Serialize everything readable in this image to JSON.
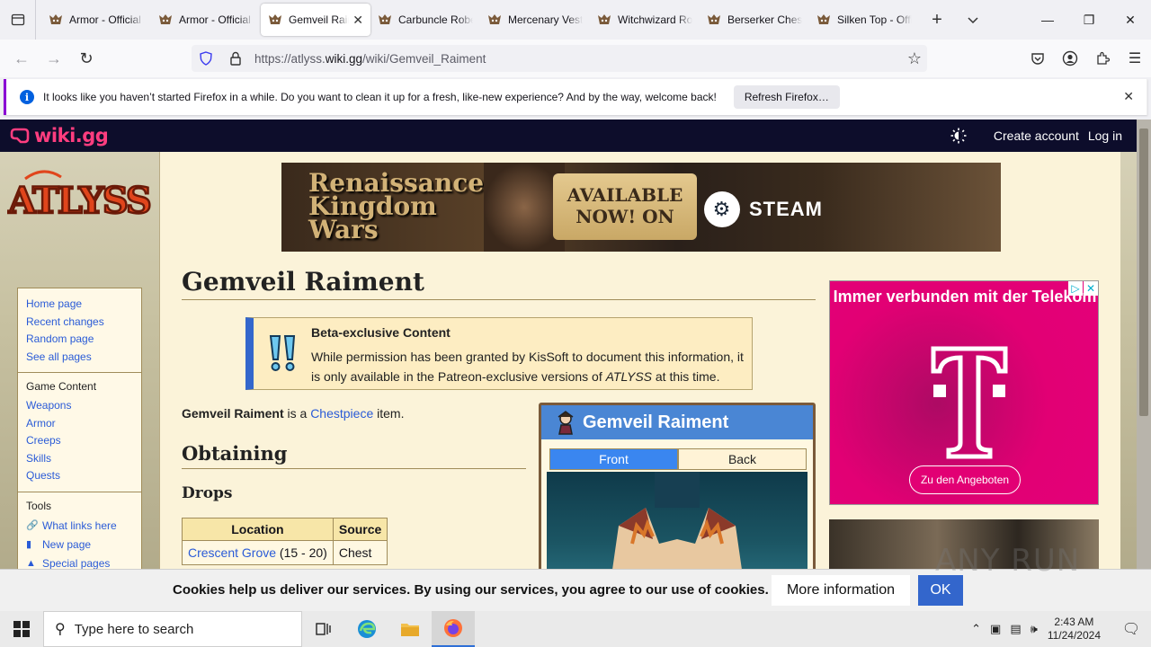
{
  "browser": {
    "tabs": [
      {
        "title": "Armor - Official ATLYSS Wiki",
        "active": false
      },
      {
        "title": "Armor - Official ATLYSS Wiki",
        "active": false
      },
      {
        "title": "Gemveil Raiment",
        "active": true
      },
      {
        "title": "Carbuncle Robe",
        "active": false
      },
      {
        "title": "Mercenary Vest",
        "active": false
      },
      {
        "title": "Witchwizard Robe",
        "active": false
      },
      {
        "title": "Berserker Chestpiece",
        "active": false
      },
      {
        "title": "Silken Top - Official ATLYSS Wiki",
        "active": false
      }
    ],
    "url_prefix": "https://atlyss.",
    "url_domain": "wiki.gg",
    "url_path": "/wiki/Gemveil_Raiment",
    "notification": {
      "message": "It looks like you haven’t started Firefox in a while. Do you want to clean it up for a fresh, like-new experience? And by the way, welcome back!",
      "button": "Refresh Firefox…"
    }
  },
  "wiki_header": {
    "logo": "wiki.gg",
    "create_account": "Create account",
    "log_in": "Log in"
  },
  "sidebar": {
    "logo_text": "ATLYSS",
    "nav": [
      "Home page",
      "Recent changes",
      "Random page",
      "See all pages"
    ],
    "game_content_heading": "Game Content",
    "game_content": [
      "Weapons",
      "Armor",
      "Creeps",
      "Skills",
      "Quests"
    ],
    "tools_heading": "Tools",
    "tools": [
      "What links here",
      "New page",
      "Special pages"
    ]
  },
  "banner": {
    "game": "Renaissance Kingdom Wars",
    "cta": "AVAILABLE NOW! ON",
    "platform": "STEAM"
  },
  "article": {
    "title": "Gemveil Raiment",
    "notice": {
      "title": "Beta-exclusive Content",
      "text_before": "While permission has been granted by KisSoft to document this information, it is only available in the Patreon-exclusive versions of ",
      "text_italic": "ATLYSS",
      "text_after": " at this time."
    },
    "intro_name": "Gemveil Raiment",
    "intro_mid": " is a ",
    "intro_link": "Chestpiece",
    "intro_end": " item.",
    "section": "Obtaining",
    "subsection": "Drops",
    "drops_table": {
      "headers": [
        "Location",
        "Source"
      ],
      "rows": [
        {
          "location": "Crescent Grove",
          "level": " (15 - 20)",
          "source": "Chest"
        }
      ]
    },
    "infobox": {
      "title": "Gemveil Raiment",
      "tabs": [
        "Front",
        "Back"
      ],
      "active_tab": "Front"
    }
  },
  "ad": {
    "headline": "Immer verbunden mit der Telekom",
    "cta": "Zu den Angeboten"
  },
  "cookie_bar": {
    "text": "Cookies help us deliver our services. By using our services, you agree to our use of cookies.",
    "more": "More information",
    "ok": "OK"
  },
  "watermark": "ANY RUN",
  "taskbar": {
    "search_placeholder": "Type here to search",
    "time": "2:43 AM",
    "date": "11/24/2024"
  },
  "colors": {
    "wiki_header_bg": "#0d0d2b",
    "wiki_logo": "#ff3d7f",
    "link": "#2a5bd7",
    "content_bg": "#fbf3d9",
    "notice_accent": "#3366cc",
    "telekom_magenta": "#e20074"
  }
}
